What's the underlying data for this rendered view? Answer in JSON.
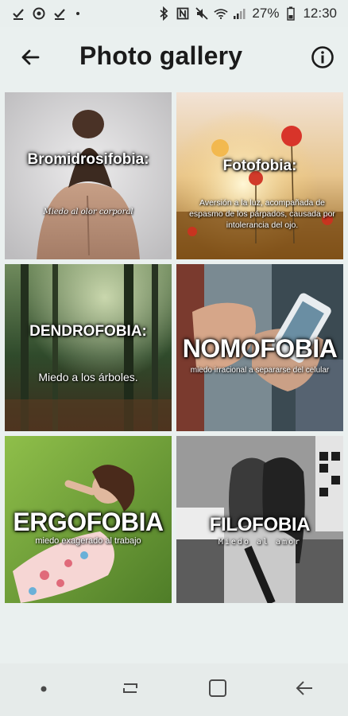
{
  "status_bar": {
    "battery": "27%",
    "time": "12:30"
  },
  "app_bar": {
    "title": "Photo gallery"
  },
  "gallery": {
    "tiles": [
      {
        "title": "Bromidrosifobia:",
        "subtitle": "Miedo al olor corporal"
      },
      {
        "title": "Fotofobia:",
        "subtitle": "Aversión a la luz, acompañada de espasmo de los párpados, causada por intolerancia del ojo."
      },
      {
        "title": "DENDROFOBIA:",
        "subtitle": "Miedo a los árboles."
      },
      {
        "title": "NOMOFOBIA",
        "subtitle": "miedo irracional a separarse del celular"
      },
      {
        "title": "ERGOFOBIA",
        "subtitle": "miedo exagerado al trabajo"
      },
      {
        "title": "FILOFOBIA",
        "subtitle": "Miedo al amor"
      }
    ]
  },
  "icons": {
    "status_left": [
      "check-icon",
      "target-icon",
      "check-icon"
    ],
    "status_right": [
      "bluetooth-icon",
      "nfc-icon",
      "mute-icon",
      "wifi-icon",
      "signal-icon",
      "battery-icon"
    ],
    "nav": [
      "recent-dot-icon",
      "recents-icon",
      "home-icon",
      "back-icon"
    ]
  },
  "colors": {
    "background": "#eaf0ef",
    "text": "#1b1b1b"
  }
}
